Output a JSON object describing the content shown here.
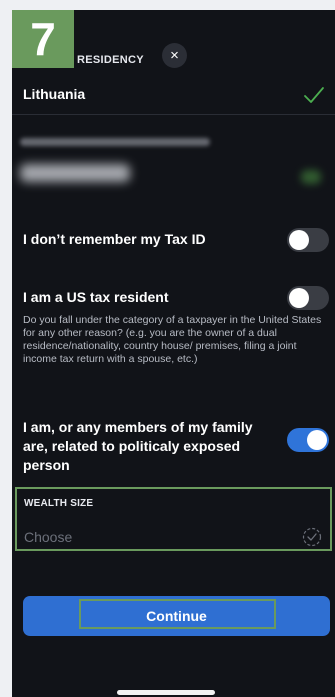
{
  "step": {
    "number": "7"
  },
  "header": {
    "title": "X RESIDENCY",
    "close_symbol": "×"
  },
  "country": {
    "value": "Lithuania",
    "icon": "check-icon"
  },
  "toggles": [
    {
      "label": "I don’t remember my Tax ID",
      "state": "off"
    },
    {
      "label": "I am a US tax resident",
      "state": "off",
      "description": "Do you fall under the category of a taxpayer in the United States for any other reason? (e.g. you are the owner of a dual residence/nationality, country house/ premises, filing a joint income tax return with a spouse, etc.)"
    },
    {
      "label_lines": [
        "I am, or any members of my family",
        "are, related to politicaly exposed",
        "person"
      ],
      "state": "on"
    }
  ],
  "wealth": {
    "label": "WEALTH SIZE",
    "placeholder": "Choose",
    "icon": "dashed-check-circle-icon"
  },
  "continue": {
    "label": "Continue"
  },
  "colors": {
    "accent_blue": "#2f6fd2",
    "highlight_green": "#6a9a5d",
    "check_green": "#4caf50"
  }
}
